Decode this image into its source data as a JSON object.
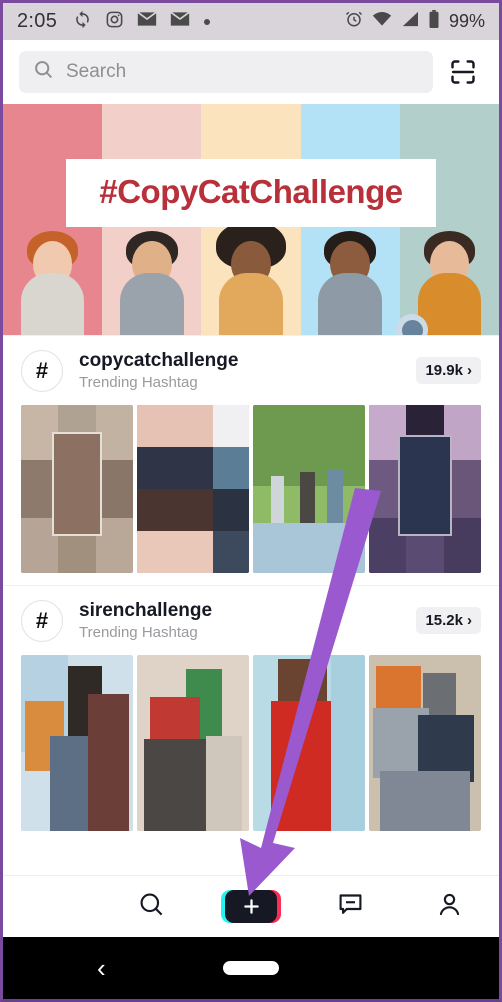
{
  "status_bar": {
    "time": "2:05",
    "battery_text": "99%",
    "left_icons": [
      "sync-icon",
      "instagram-icon",
      "mail-icon",
      "mail-icon",
      "dot-icon"
    ],
    "right_icons": [
      "alarm-icon",
      "wifi-icon",
      "cellular-signal-icon",
      "battery-icon"
    ],
    "background_color": "#d8d4da"
  },
  "search": {
    "placeholder": "Search",
    "icon": "search-icon",
    "scan_icon": "qr-scan-icon"
  },
  "banner": {
    "title": "#CopyCatChallenge",
    "title_color": "#b8303a",
    "stripe_colors": [
      "#e8868f",
      "#f2cfc9",
      "#fbe3bd",
      "#b3e2f7",
      "#b2cfcb"
    ],
    "people_count": 5,
    "cursor_indicator": "touch-pointer-dot"
  },
  "sections": [
    {
      "hashtag": "copycatchallenge",
      "subtitle": "Trending Hashtag",
      "count": "19.9k",
      "chevron": "›",
      "hash_icon": "#",
      "thumbnails": [
        {
          "name": "thumbnail-copycat-1",
          "colors": [
            "#b9aca0",
            "#7d6a5e",
            "#cdbfb4",
            "#6d5c52"
          ]
        },
        {
          "name": "thumbnail-copycat-2",
          "colors": [
            "#e9c9bd",
            "#2c3344",
            "#d8b3a6",
            "#3b4256"
          ]
        },
        {
          "name": "thumbnail-copycat-3",
          "colors": [
            "#7fa35c",
            "#9bbf72",
            "#5d7f46",
            "#a9c6d8"
          ]
        },
        {
          "name": "thumbnail-copycat-4",
          "colors": [
            "#6b4a7e",
            "#3a3550",
            "#8e6aa0",
            "#2a2740"
          ]
        }
      ]
    },
    {
      "hashtag": "sirenchallenge",
      "subtitle": "Trending Hashtag",
      "count": "15.2k",
      "chevron": "›",
      "hash_icon": "#",
      "thumbnails": [
        {
          "name": "thumbnail-siren-1",
          "colors": [
            "#cfe0ea",
            "#d98c3e",
            "#7b5a4a",
            "#3e5a70"
          ]
        },
        {
          "name": "thumbnail-siren-2",
          "colors": [
            "#ded3c6",
            "#3f8a4d",
            "#c03a33",
            "#58514c"
          ]
        },
        {
          "name": "thumbnail-siren-3",
          "colors": [
            "#b9dbe6",
            "#cf2b22",
            "#9fc8d6",
            "#7a2a22"
          ]
        },
        {
          "name": "thumbnail-siren-4",
          "colors": [
            "#cbbfae",
            "#d9752e",
            "#8e97a2",
            "#5a6470"
          ]
        }
      ]
    }
  ],
  "bottom_nav": {
    "items": [
      {
        "name": "nav-home",
        "icon": "home-icon",
        "label": ""
      },
      {
        "name": "nav-discover",
        "icon": "search-icon",
        "label": ""
      },
      {
        "name": "nav-create",
        "icon": "plus-icon",
        "label": ""
      },
      {
        "name": "nav-inbox",
        "icon": "inbox-message-icon",
        "label": ""
      },
      {
        "name": "nav-profile",
        "icon": "person-icon",
        "label": ""
      }
    ],
    "create_colors": {
      "left": "#25f4ee",
      "right": "#fe2c55",
      "center": "#161823"
    }
  },
  "system_nav": {
    "back_icon": "‹",
    "home_indicator": "home-pill",
    "background_color": "#000000"
  },
  "annotation": {
    "arrow_color": "#9b59d0",
    "points_to": "nav-create"
  }
}
